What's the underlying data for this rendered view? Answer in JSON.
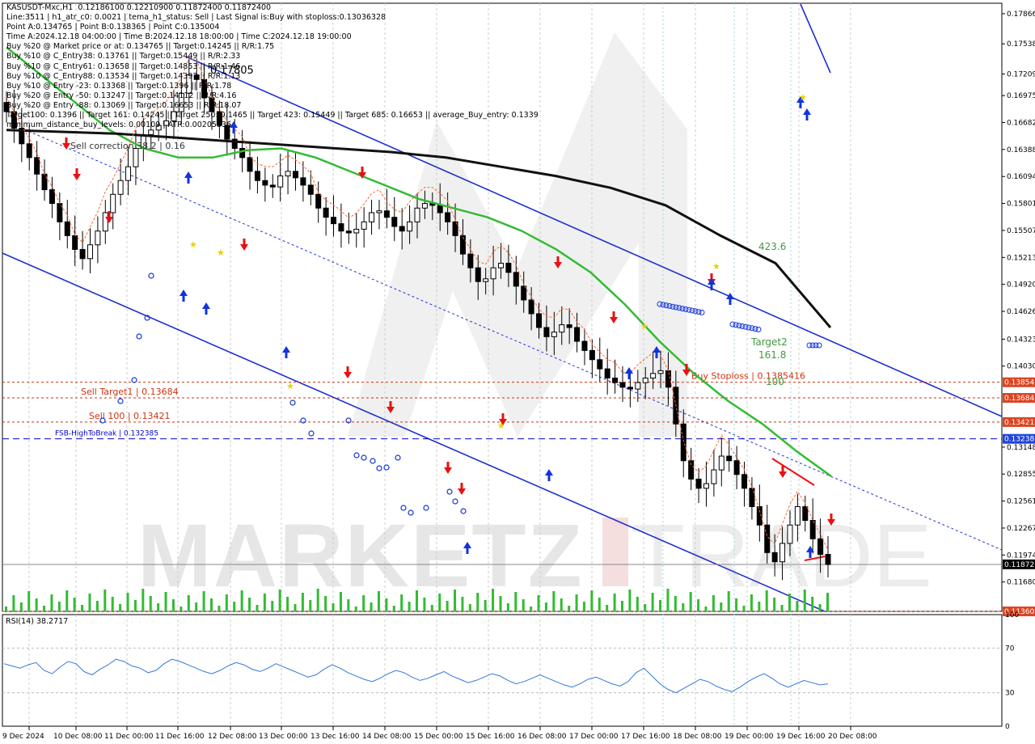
{
  "window_title": "KASUSDT-Mxc,H1",
  "info_lines": [
    "KASUSDT-Mxc,H1  0.12186100 0.12210900 0.11872400 0.11872400",
    "Line:3511 | h1_atr_c0: 0.0021 | tema_h1_status: Sell | Last Signal is:Buy with stoploss:0.13036328",
    "Point A:0.134765 | Point B:0.138365 | Point C:0.135004",
    "Time A:2024.12.18 04:00:00 | Time B:2024.12.18 18:00:00 | Time C:2024.12.18 19:00:00",
    "Buy %20 @ Market price or at: 0.134765 || Target:0.14245 || R/R:1.75",
    "Buy %10 @ C_Entry38: 0.13761 || Target:0.15449 || R/R:2.33",
    "Buy %10 @ C_Entry61: 0.13658 || Target:0.14853 || R/R:1.46",
    "Buy %10 @ C_Entry88: 0.13534 || Target:0.14397 || R/R:1.13",
    "Buy %10 @ Entry -23: 0.13368 || Target:0.1396 || R/R:1.78",
    "Buy %20 @ Entry -50: 0.13247 || Target:0.14112 || R/R:4.16",
    "Buy %20 @ Entry -88: 0.13069 || Target:0.16653 || R/R:18.07",
    "Target100: 0.1396 || Target 161: 0.14245 || Target 250: 0.1465 || Target 423: 0.15449 || Target 685: 0.16653 || average_Buy_entry: 0.1339",
    "minimum_distance_buy_levels: 0.00109 | ATR:0.00205836"
  ],
  "chart_data": {
    "type": "candlestick",
    "symbol": "KASUSDT-Mxc",
    "timeframe": "H1",
    "ohlc_last": {
      "open": 0.121861,
      "high": 0.122109,
      "low": 0.118724,
      "close": 0.118724
    },
    "y_axis": {
      "ylim": [
        0.1136,
        0.1798
      ],
      "tick_labels": [
        "0.17866",
        "0.17538",
        "0.17209",
        "0.16975",
        "0.16682",
        "0.16388",
        "0.16094",
        "0.15801",
        "0.15507",
        "0.15213",
        "0.14920",
        "0.14626",
        "0.14323",
        "0.14030",
        "0.13148",
        "0.12855",
        "0.12561",
        "0.12267",
        "0.11974",
        "0.11680"
      ]
    },
    "x_axis": {
      "tick_labels": [
        "9 Dec 2024",
        "10 Dec 08:00",
        "11 Dec 00:00",
        "11 Dec 16:00",
        "12 Dec 08:00",
        "13 Dec 00:00",
        "13 Dec 16:00",
        "14 Dec 08:00",
        "15 Dec 00:00",
        "15 Dec 16:00",
        "16 Dec 08:00",
        "17 Dec 00:00",
        "17 Dec 16:00",
        "18 Dec 08:00",
        "19 Dec 00:00",
        "19 Dec 16:00",
        "20 Dec 08:00"
      ]
    },
    "close_series": [
      0.168,
      0.1662,
      0.1645,
      0.163,
      0.1612,
      0.1595,
      0.158,
      0.156,
      0.1545,
      0.153,
      0.152,
      0.1535,
      0.155,
      0.157,
      0.159,
      0.1605,
      0.162,
      0.164,
      0.1655,
      0.166,
      0.1665,
      0.167,
      0.168,
      0.17,
      0.172,
      0.1715,
      0.1695,
      0.168,
      0.1665,
      0.165,
      0.164,
      0.163,
      0.1615,
      0.1605,
      0.16,
      0.1598,
      0.161,
      0.1615,
      0.1608,
      0.16,
      0.159,
      0.1575,
      0.1565,
      0.1558,
      0.155,
      0.1548,
      0.1552,
      0.156,
      0.157,
      0.1572,
      0.1565,
      0.1555,
      0.155,
      0.156,
      0.1575,
      0.158,
      0.1578,
      0.157,
      0.156,
      0.1545,
      0.1525,
      0.151,
      0.1495,
      0.1498,
      0.151,
      0.1515,
      0.1505,
      0.149,
      0.1475,
      0.146,
      0.1445,
      0.1435,
      0.144,
      0.1448,
      0.1445,
      0.143,
      0.142,
      0.141,
      0.14,
      0.139,
      0.1385,
      0.138,
      0.1378,
      0.1385,
      0.139,
      0.1395,
      0.1398,
      0.138,
      0.134,
      0.13,
      0.128,
      0.127,
      0.1275,
      0.129,
      0.1305,
      0.13,
      0.1285,
      0.127,
      0.125,
      0.123,
      0.12,
      0.119,
      0.121,
      0.123,
      0.125,
      0.1235,
      0.1215,
      0.1198,
      0.1187
    ],
    "indicator_lines": [
      {
        "name": "ma_green",
        "color": "#33bb33",
        "values": [
          0.175,
          0.172,
          0.169,
          0.166,
          0.164,
          0.163,
          0.163,
          0.1638,
          0.164,
          0.163,
          0.1615,
          0.16,
          0.1585,
          0.1575,
          0.1565,
          0.155,
          0.153,
          0.1505,
          0.147,
          0.143,
          0.1395,
          0.1365,
          0.134,
          0.131,
          0.1283
        ]
      },
      {
        "name": "ma_black",
        "color": "#111111",
        "values": [
          0.166,
          0.1658,
          0.1656,
          0.1652,
          0.1648,
          0.1644,
          0.164,
          0.1636,
          0.163,
          0.162,
          0.161,
          0.1597,
          0.1578,
          0.1545,
          0.1515,
          0.1445
        ]
      }
    ],
    "price_labels": [
      {
        "text": "0.13854",
        "color": "#dd4422"
      },
      {
        "text": "0.13684",
        "color": "#dd4422"
      },
      {
        "text": "0.13421",
        "color": "#dd4422"
      },
      {
        "text": "0.13238",
        "color": "#2244dd"
      },
      {
        "text": "0.11872",
        "color": "#000000"
      },
      {
        "text": "0.11360",
        "color": "#dd4422"
      }
    ],
    "levels": [
      {
        "label": "Sell Target1 | 0.13684",
        "value": 0.13684,
        "color": "#cc3311"
      },
      {
        "label": "Sell 100 | 0.13421",
        "value": 0.13421,
        "color": "#cc3311"
      },
      {
        "label": "FSB-HighToBreak | 0.132385",
        "value": 0.132385,
        "color": "#0000cc"
      },
      {
        "label": "Buy Stoploss | 0.1385416",
        "value": 0.1385416,
        "color": "#cc3311"
      },
      {
        "value": 0.1136,
        "color": "#cc3311"
      }
    ],
    "annotations": [
      "0.17805",
      "Sell correction 38.2 | 0.16",
      "423.6",
      "Target2",
      "161.8",
      "100"
    ],
    "rsi": {
      "label": "RSI(14) 38.2717",
      "ylim": [
        0,
        100
      ],
      "ticks": [
        "100",
        "70",
        "30",
        "0"
      ],
      "values": [
        56,
        54,
        52,
        55,
        57,
        50,
        47,
        53,
        58,
        56,
        49,
        46,
        51,
        55,
        60,
        58,
        54,
        52,
        48,
        50,
        56,
        60,
        58,
        55,
        52,
        49,
        47,
        50,
        54,
        57,
        55,
        51,
        49,
        52,
        56,
        53,
        50,
        47,
        44,
        46,
        51,
        55,
        52,
        48,
        45,
        42,
        40,
        43,
        47,
        50,
        48,
        44,
        41,
        43,
        46,
        49,
        45,
        42,
        39,
        41,
        44,
        47,
        45,
        41,
        38,
        40,
        43,
        46,
        43,
        40,
        37,
        35,
        38,
        42,
        44,
        41,
        38,
        36,
        40,
        48,
        52,
        45,
        38,
        33,
        30,
        34,
        38,
        42,
        40,
        36,
        33,
        31,
        35,
        40,
        44,
        47,
        43,
        38,
        35,
        38,
        41,
        39,
        37,
        38
      ]
    }
  }
}
